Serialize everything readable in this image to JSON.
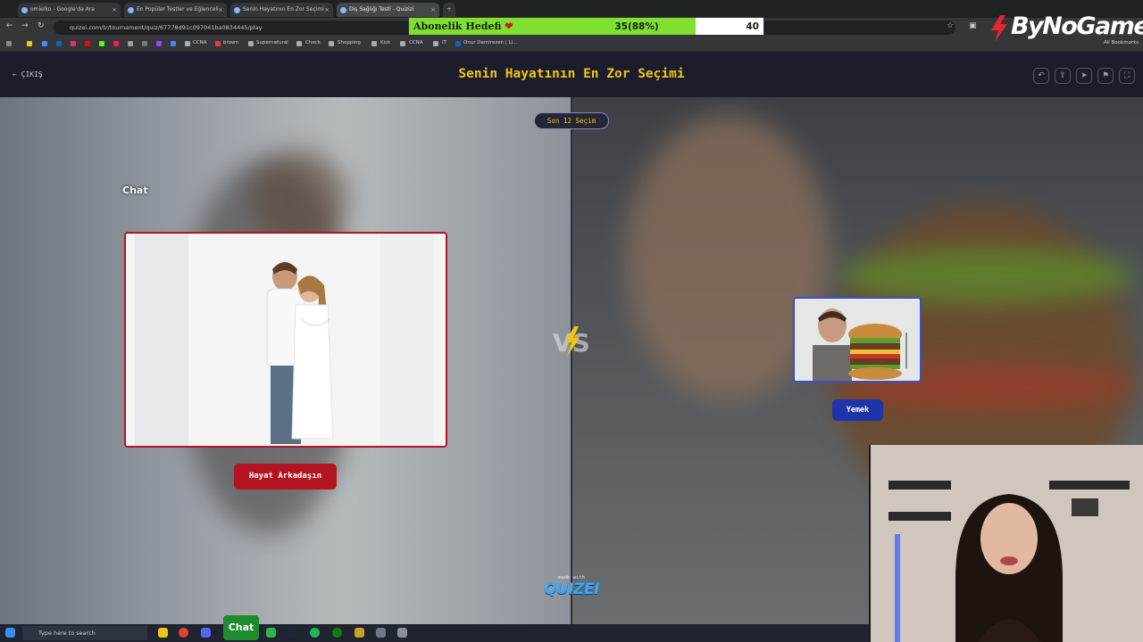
{
  "browser": {
    "tabs": [
      {
        "label": "omielko - Google'da Ara"
      },
      {
        "label": "En Popüler Testler ve Eğlenceli"
      },
      {
        "label": "Senin Hayatının En Zor Seçimi"
      },
      {
        "label": "Diş Sağlığı Testi - Quizizi"
      }
    ],
    "url": "quizei.com/tr/tournament/quiz/67778d91c097041ba0834445/play",
    "bookmarks": [
      "CCNA",
      "brown",
      "Supernatural",
      "Check",
      "Shopping",
      "Kick",
      "CCNA",
      "IT",
      "Onur Demirezen | Li..."
    ],
    "all_bookmarks": "All Bookmarks"
  },
  "goal": {
    "title": "Abonelik Hedefi",
    "heart": "❤",
    "count": "35(88%)",
    "target": "40",
    "progress": 0.88
  },
  "streamer_logo": "ByNoGame",
  "header": {
    "exit_label": "ÇIKIŞ",
    "title": "Senin Hayatının En Zor Seçimi",
    "icons": [
      "undo-icon",
      "share-icon",
      "send-icon",
      "flag-icon",
      "fullscreen-icon"
    ]
  },
  "match": {
    "round_label": "Son 12 Seçim",
    "left_option": "Hayat Arkadaşın",
    "right_option": "Yemek",
    "vs_label": "VS"
  },
  "overlay_chat": "Chat",
  "footer": {
    "made_with": "made with",
    "brand": "QUIZEI"
  },
  "taskbar": {
    "search_placeholder": "Type here to search",
    "chat_button": "Chat"
  },
  "colors": {
    "accent_yellow": "#f1c40f",
    "left_red": "#b31422",
    "right_blue": "#1e34a8",
    "goal_green": "#7fe02f"
  }
}
